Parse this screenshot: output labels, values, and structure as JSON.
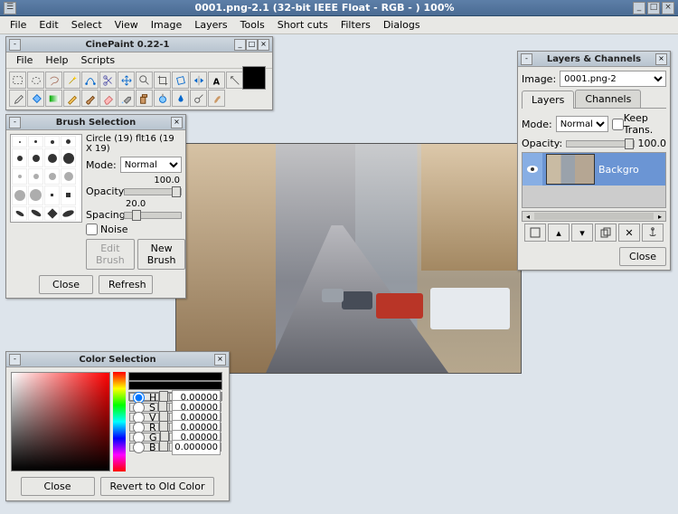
{
  "main_window": {
    "title": "0001.png-2.1 (32-bit IEEE Float - RGB - ) 100%",
    "menu": [
      "File",
      "Edit",
      "Select",
      "View",
      "Image",
      "Layers",
      "Tools",
      "Short cuts",
      "Filters",
      "Dialogs"
    ]
  },
  "toolbox": {
    "title": "CinePaint 0.22-1",
    "menu": [
      "File",
      "Help",
      "Scripts"
    ],
    "tools": [
      "rect-select",
      "ellipse-select",
      "lasso",
      "magic-wand",
      "bezier",
      "scissors",
      "move",
      "zoom",
      "crop",
      "transform",
      "flip",
      "text",
      "measure",
      "fg-swatch",
      "eyedropper",
      "bucket",
      "blend",
      "pencil",
      "brush",
      "eraser",
      "airbrush",
      "clone",
      "convolve",
      "ink",
      "dodge",
      "smudge"
    ]
  },
  "brush": {
    "title": "Brush Selection",
    "name": "Circle (19) flt16  (19 X 19)",
    "mode_label": "Mode:",
    "mode_value": "Normal",
    "opacity_label": "Opacity:",
    "opacity_value": "100.0",
    "spacing_label": "Spacing:",
    "spacing_value": "20.0",
    "noise_label": "Noise",
    "edit_btn": "Edit Brush",
    "new_btn": "New Brush",
    "close_btn": "Close",
    "refresh_btn": "Refresh"
  },
  "color": {
    "title": "Color Selection",
    "channels": [
      "H",
      "S",
      "V",
      "R",
      "G",
      "B"
    ],
    "values": [
      "0.00000",
      "0.00000",
      "0.00000",
      "0.00000",
      "0.00000",
      "0.000000"
    ],
    "close_btn": "Close",
    "revert_btn": "Revert to Old Color"
  },
  "layers": {
    "title": "Layers & Channels",
    "image_label": "Image:",
    "image_value": "0001.png-2",
    "tabs": [
      "Layers",
      "Channels"
    ],
    "mode_label": "Mode:",
    "mode_value": "Normal",
    "keep_trans": "Keep Trans.",
    "opacity_label": "Opacity:",
    "opacity_value": "100.0",
    "layer_name": "Backgro",
    "close_btn": "Close",
    "btn_icons": [
      "new",
      "raise",
      "lower",
      "duplicate",
      "delete",
      "anchor"
    ]
  }
}
